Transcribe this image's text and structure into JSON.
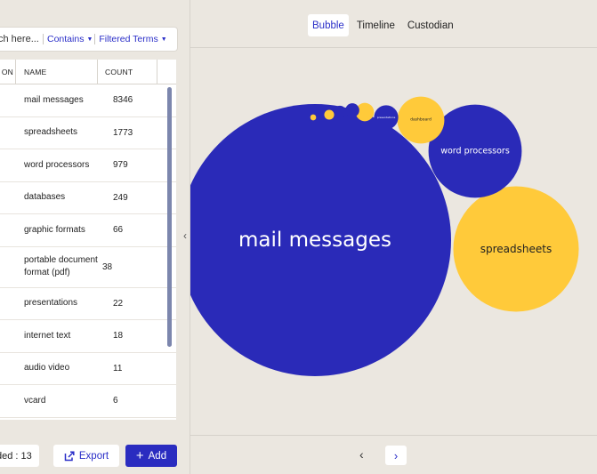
{
  "search": {
    "placeholder": "ch here...",
    "filter_mode": "Contains",
    "filter_terms": "Filtered Terms",
    "caret": "▼"
  },
  "table": {
    "headers": {
      "c0": "ON",
      "name": "NAME",
      "count": "COUNT"
    },
    "rows": [
      {
        "name": "mail messages",
        "count": "8346"
      },
      {
        "name": "spreadsheets",
        "count": "1773"
      },
      {
        "name": "word processors",
        "count": "979"
      },
      {
        "name": "databases",
        "count": "249"
      },
      {
        "name": "graphic formats",
        "count": "66"
      },
      {
        "name": "portable document format (pdf)",
        "count": "38"
      },
      {
        "name": "presentations",
        "count": "22"
      },
      {
        "name": "internet text",
        "count": "18"
      },
      {
        "name": "audio video",
        "count": "11"
      },
      {
        "name": "vcard",
        "count": "6"
      }
    ]
  },
  "footer": {
    "count_label": "ded : 13",
    "export_label": "Export",
    "add_label": "Add",
    "add_icon": "+"
  },
  "view_tabs": [
    {
      "label": "Bubble",
      "active": true
    },
    {
      "label": "Timeline",
      "active": false
    },
    {
      "label": "Custodian",
      "active": false
    }
  ],
  "pager": {
    "prev": "‹",
    "next": "›"
  },
  "collapse": "‹",
  "colors": {
    "blue": "#2a2ab8",
    "yellow": "#ffca3a",
    "accent": "#2a2ec8"
  },
  "chart_data": {
    "type": "bubble",
    "series": [
      {
        "label": "mail messages",
        "value": 8346,
        "color": "#2a2ab8"
      },
      {
        "label": "spreadsheets",
        "value": 1773,
        "color": "#ffca3a"
      },
      {
        "label": "word processors",
        "value": 979,
        "color": "#2a2ab8"
      },
      {
        "label": "dashboard",
        "value": 249,
        "color": "#ffca3a"
      },
      {
        "label": "presentations",
        "value": 66,
        "color": "#2a2ab8"
      },
      {
        "label": "",
        "value": 38,
        "color": "#ffca3a"
      },
      {
        "label": "",
        "value": 22,
        "color": "#2a2ab8"
      },
      {
        "label": "",
        "value": 18,
        "color": "#2a2ab8"
      },
      {
        "label": "",
        "value": 11,
        "color": "#ffca3a"
      },
      {
        "label": "",
        "value": 6,
        "color": "#2a2ab8"
      },
      {
        "label": "",
        "value": 4,
        "color": "#ffca3a"
      },
      {
        "label": "",
        "value": 3,
        "color": "#2a2ab8"
      }
    ]
  }
}
